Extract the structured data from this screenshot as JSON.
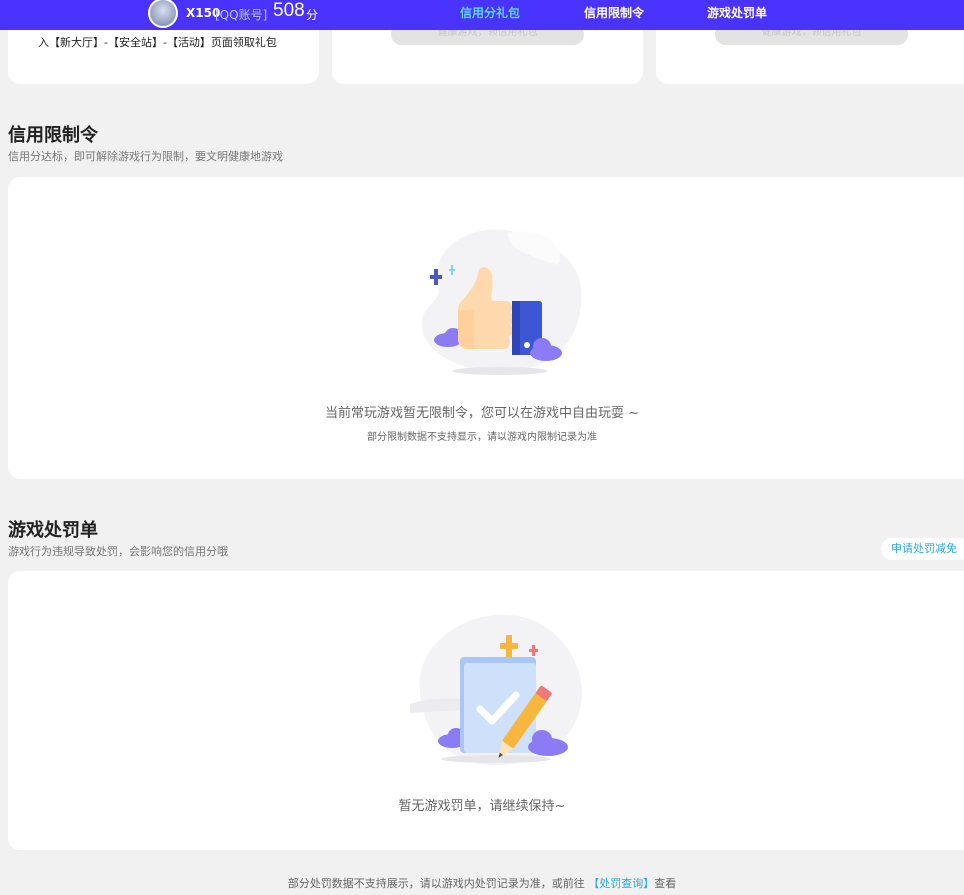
{
  "header": {
    "user_name": "X150",
    "account_type": "[QQ账号]",
    "score": "508",
    "score_unit": "分",
    "tabs": [
      {
        "label": "信用分礼包",
        "active": true
      },
      {
        "label": "信用限制令",
        "active": false
      },
      {
        "label": "游戏处罚单",
        "active": false
      }
    ]
  },
  "gift_cards": {
    "card1_text": "入【新大厅】-【安全站】-【活动】页面领取礼包",
    "card2_button": "健康游戏，领信用礼包",
    "card3_button": "健康游戏，领信用礼包"
  },
  "limit_section": {
    "title": "信用限制令",
    "subtitle": "信用分达标，即可解除游戏行为限制，要文明健康地游戏",
    "empty_main": "当前常玩游戏暂无限制令，您可以在游戏中自由玩耍 ~",
    "empty_sub": "部分限制数据不支持显示，请以游戏内限制记录为准"
  },
  "penalty_section": {
    "title": "游戏处罚单",
    "subtitle": "游戏行为违规导致处罚，会影响您的信用分哦",
    "appeal_button": "申请处罚减免",
    "empty_main": "暂无游戏罚单，请继续保持~"
  },
  "footer": {
    "note_prefix": "部分处罚数据不支持展示，请以游戏内处罚记录为准，或前往 ",
    "link_text": "【处罚查询】",
    "note_suffix": "查看"
  },
  "colors": {
    "nav_bg": "#4a33ff",
    "active_tab": "#5fd4ff",
    "link": "#2aa8e8",
    "page_bg": "#f1f1f1"
  },
  "icons": {
    "limit_illustration": "thumbs-up-icon",
    "penalty_illustration": "clipboard-pencil-icon",
    "avatar": "user-avatar"
  }
}
